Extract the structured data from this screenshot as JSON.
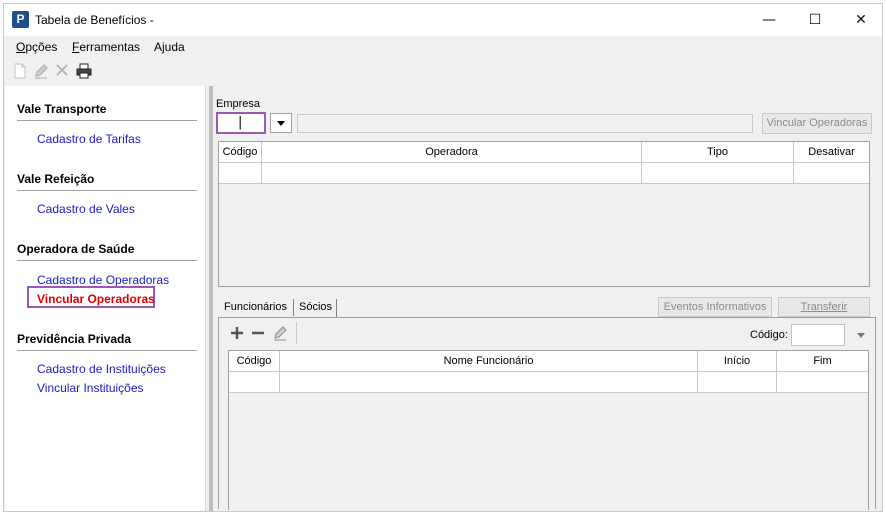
{
  "window": {
    "title": "Tabela de Benefícios -",
    "controls": {
      "minimize": "—",
      "maximize": "☐",
      "close": "✕"
    }
  },
  "menubar": {
    "items": [
      {
        "label_u": "O",
        "label_rest": "pções"
      },
      {
        "label_u": "F",
        "label_rest": "erramentas"
      },
      {
        "label_u": "",
        "label_rest": "Ajuda"
      }
    ]
  },
  "toolbar": {
    "icons": [
      "new-document-icon",
      "edit-pencil-icon",
      "delete-x-icon",
      "printer-icon"
    ]
  },
  "sidebar": {
    "sections": [
      {
        "title": "Vale Transporte",
        "links": [
          "Cadastro de Tarifas"
        ]
      },
      {
        "title": "Vale Refeição",
        "links": [
          "Cadastro de Vales"
        ]
      },
      {
        "title": "Operadora de Saúde",
        "links": [
          "Cadastro de Operadoras",
          "Vincular Operadoras"
        ]
      },
      {
        "title": "Previdência Privada",
        "links": [
          "Cadastro de Instituições",
          "Vincular Instituições"
        ]
      }
    ],
    "active_link": "Vincular Operadoras"
  },
  "main": {
    "empresa_label": "Empresa",
    "empresa_value": "|",
    "empresa_description": "",
    "vincular_button": "Vincular Operadoras",
    "operadoras_grid": {
      "columns": [
        "Código",
        "Operadora",
        "Tipo",
        "Desativar"
      ]
    },
    "tabs": [
      "Funcionários",
      "Sócios"
    ],
    "eventos_button": "Eventos Informativos",
    "transferir_button": "Transferir",
    "codigo_label": "Código:",
    "codigo_value": "",
    "funcionarios_grid": {
      "columns": [
        "Código",
        "Nome Funcionário",
        "Início",
        "Fim"
      ]
    }
  },
  "colors": {
    "link": "#1a1acc",
    "active_link": "#e00000",
    "highlight_border": "#9b59b6",
    "app_icon": "#1f4e8c"
  }
}
